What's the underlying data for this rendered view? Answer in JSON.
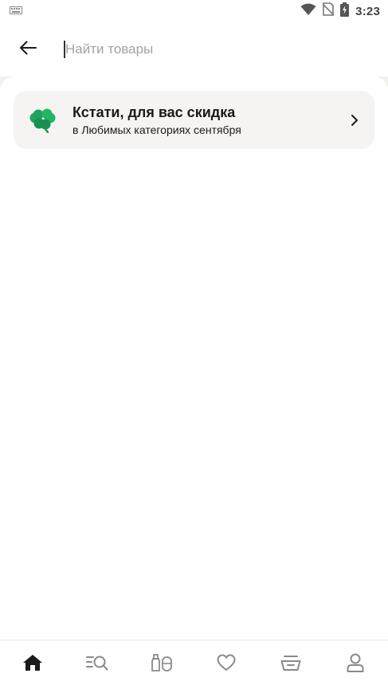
{
  "status_bar": {
    "time": "3:23"
  },
  "header": {
    "back_icon": "arrow-left-icon",
    "search": {
      "placeholder": "Найти товары",
      "value": ""
    }
  },
  "promo": {
    "icon": "clover-icon",
    "title": "Кстати, для вас скидка",
    "subtitle": "в Любимых категориях сентября",
    "chevron_icon": "chevron-right-icon"
  },
  "bottom_nav": {
    "items": [
      {
        "icon": "home-icon",
        "active": true
      },
      {
        "icon": "catalog-search-icon",
        "active": false
      },
      {
        "icon": "products-icon",
        "active": false
      },
      {
        "icon": "heart-icon",
        "active": false
      },
      {
        "icon": "cart-icon",
        "active": false
      },
      {
        "icon": "profile-icon",
        "active": false
      }
    ]
  },
  "colors": {
    "active_nav": "#1a1a1a",
    "inactive_nav": "#8a8a8a",
    "clover": "#1fa35c",
    "card_bg": "#f5f4f2"
  }
}
